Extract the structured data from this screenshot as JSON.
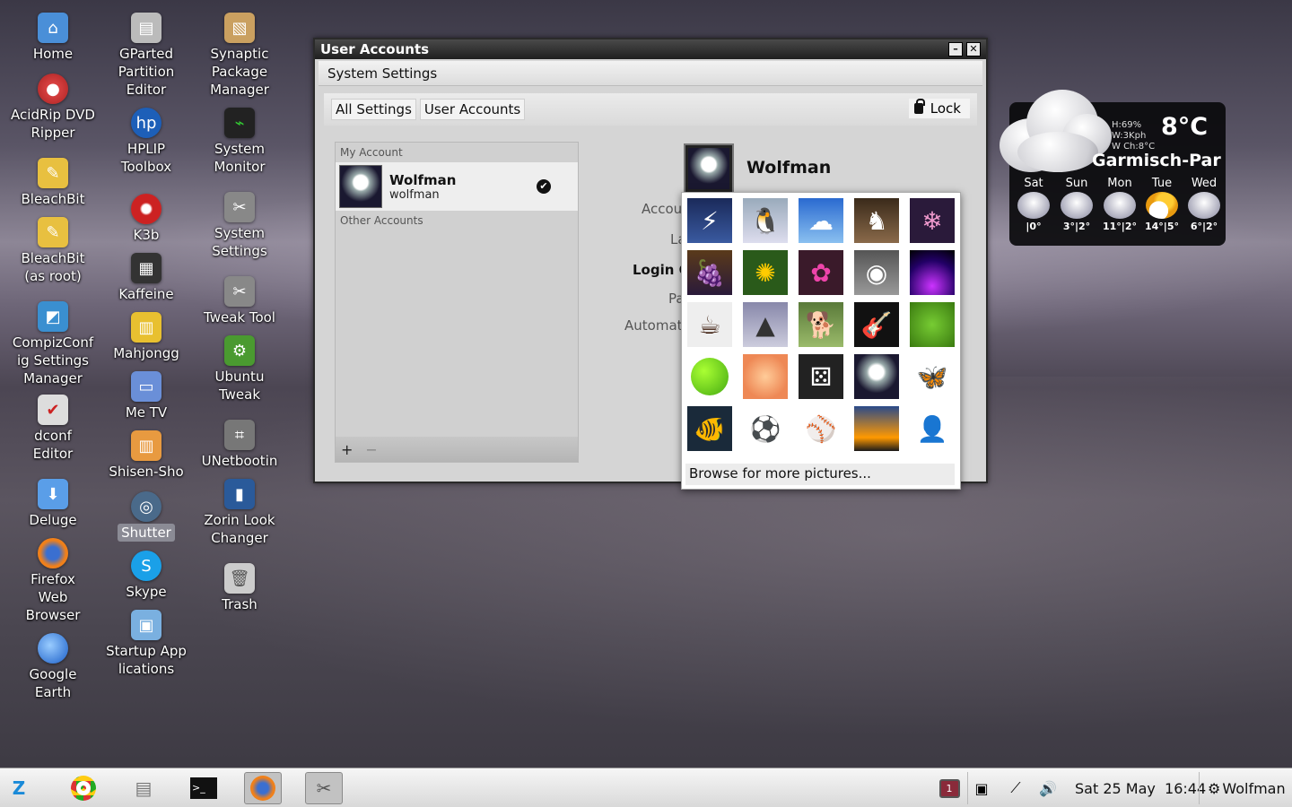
{
  "desktop": {
    "icons": [
      {
        "label": "Home",
        "icon": "folder-home-icon"
      },
      {
        "label": "AcidRip DVD Ripper",
        "icon": "dvd-icon"
      },
      {
        "label": "BleachBit",
        "icon": "broom-icon"
      },
      {
        "label": "BleachBit (as root)",
        "icon": "broom-icon"
      },
      {
        "label": "CompizConfig Settings Manager",
        "icon": "compiz-icon"
      },
      {
        "label": "dconf Editor",
        "icon": "checkmark-icon"
      },
      {
        "label": "Deluge",
        "icon": "download-icon"
      },
      {
        "label": "Firefox Web Browser",
        "icon": "firefox-icon"
      },
      {
        "label": "Google Earth",
        "icon": "globe-icon"
      },
      {
        "label": "GParted Partition Editor",
        "icon": "disk-icon"
      },
      {
        "label": "HPLIP Toolbox",
        "icon": "hp-icon"
      },
      {
        "label": "K3b",
        "icon": "k3b-icon"
      },
      {
        "label": "Kaffeine",
        "icon": "clapper-icon"
      },
      {
        "label": "Mahjongg",
        "icon": "tiles-icon"
      },
      {
        "label": "Me TV",
        "icon": "tv-icon"
      },
      {
        "label": "Shisen-Sho",
        "icon": "tiles-icon"
      },
      {
        "label": "Shutter",
        "icon": "shutter-icon"
      },
      {
        "label": "Skype",
        "icon": "skype-icon"
      },
      {
        "label": "Startup Applications",
        "icon": "startup-icon"
      },
      {
        "label": "Synaptic Package Manager",
        "icon": "package-icon"
      },
      {
        "label": "System Monitor",
        "icon": "monitor-icon"
      },
      {
        "label": "System Settings",
        "icon": "tools-icon"
      },
      {
        "label": "Tweak Tool",
        "icon": "tools-icon"
      },
      {
        "label": "Ubuntu Tweak",
        "icon": "gear-icon"
      },
      {
        "label": "UNetbootin",
        "icon": "usb-icon"
      },
      {
        "label": "Zorin Look Changer",
        "icon": "brush-icon"
      },
      {
        "label": "Trash",
        "icon": "trash-icon"
      }
    ]
  },
  "window": {
    "title": "User Accounts",
    "menubar_title": "System Settings",
    "breadcrumbs": [
      "All Settings",
      "User Accounts"
    ],
    "lock_label": "Lock",
    "my_account_label": "My Account",
    "account": {
      "display_name": "Wolfman",
      "username": "wolfman"
    },
    "other_accounts_label": "Other Accounts",
    "add_label": "+",
    "remove_label": "−",
    "user_heading": "Wolfman",
    "field_labels": [
      "Accou",
      "La",
      "Login O",
      "Pa",
      "Automat"
    ]
  },
  "picture_picker": {
    "pictures": [
      "lightning",
      "penguin",
      "clouds",
      "chess",
      "snowflake",
      "grapes",
      "sunflower",
      "flower",
      "cat-eye",
      "plasma",
      "coffee",
      "space-shuttle",
      "puppy",
      "guitar",
      "leaf",
      "tennis-ball",
      "rose",
      "dice",
      "astronaut",
      "butterfly",
      "clownfish",
      "soccer-ball",
      "baseball",
      "sunset",
      "person"
    ],
    "browse_label": "Browse for more pictures..."
  },
  "weather": {
    "humidity": "H:69%",
    "wind": "W:3Kph",
    "wind_chill": "W Ch:8°C",
    "temperature": "8°C",
    "city": "Garmisch-Par",
    "forecast": [
      {
        "day": "Sat",
        "temps": "|0°",
        "icon": "snow-cloud-icon"
      },
      {
        "day": "Sun",
        "temps": "3°|2°",
        "icon": "snow-cloud-icon"
      },
      {
        "day": "Mon",
        "temps": "11°|2°",
        "icon": "rain-cloud-icon"
      },
      {
        "day": "Tue",
        "temps": "14°|5°",
        "icon": "sun-cloud-icon"
      },
      {
        "day": "Wed",
        "temps": "6°|2°",
        "icon": "rain-cloud-icon"
      }
    ]
  },
  "taskbar": {
    "launchers": [
      "zorin-menu-icon",
      "chrome-icon",
      "files-icon",
      "terminal-icon",
      "firefox-icon",
      "tools-icon"
    ],
    "notification_count": "1",
    "clock": "Sat 25 May  16:44",
    "user": "Wolfman"
  },
  "colors": {
    "titlebar": "#1f1f1f",
    "window_bg": "#d5d5d5",
    "weather_bg": "#0a0a0c",
    "taskbar": "#e6e6e6"
  }
}
